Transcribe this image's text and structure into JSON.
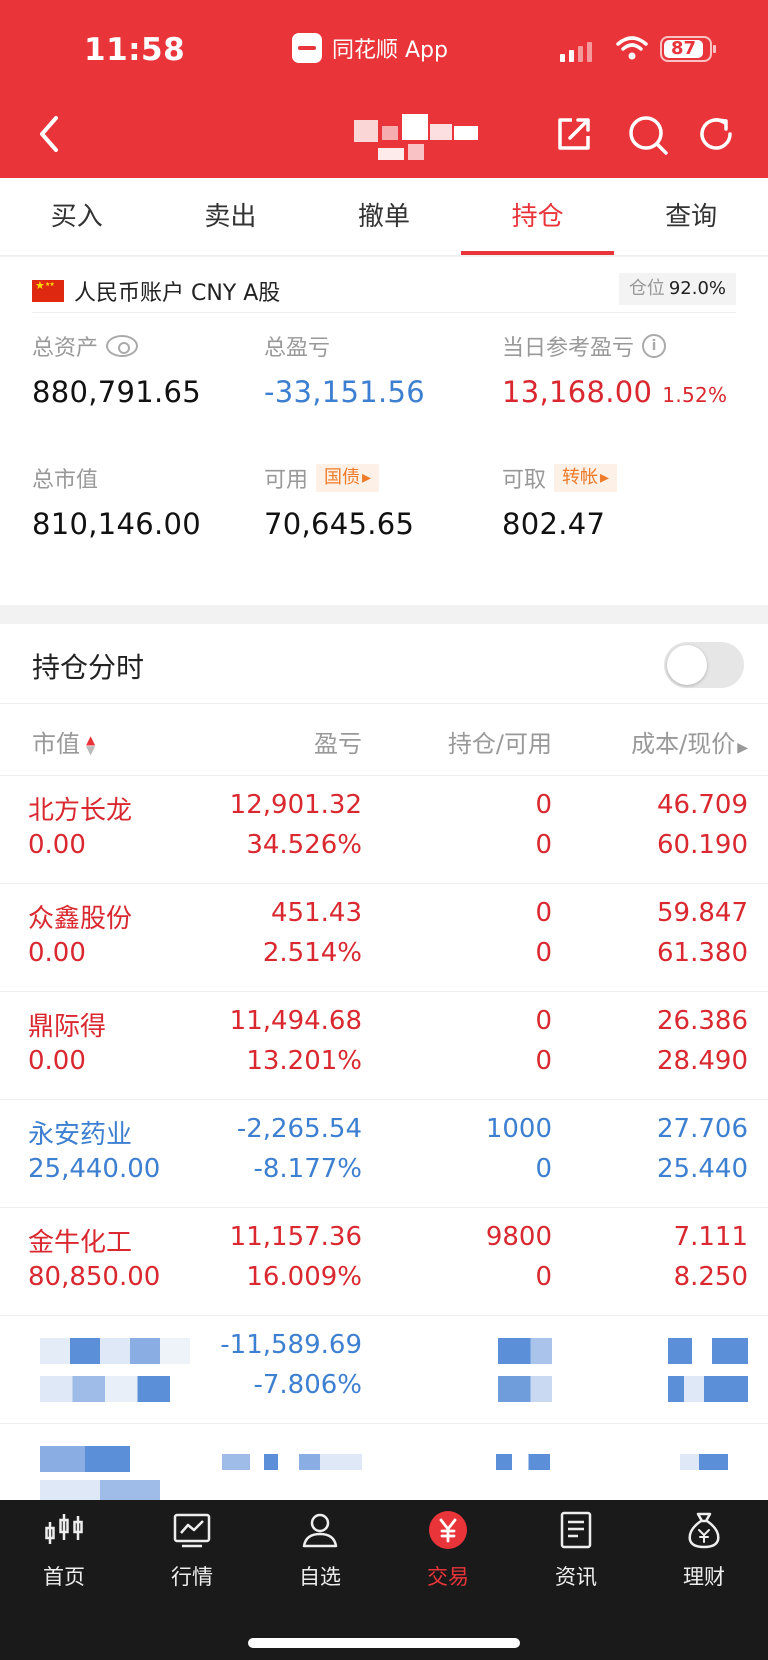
{
  "status": {
    "time": "11:58",
    "app": "同花顺 App",
    "battery": "87"
  },
  "tabs": [
    {
      "label": "买入",
      "active": false
    },
    {
      "label": "卖出",
      "active": false
    },
    {
      "label": "撤单",
      "active": false
    },
    {
      "label": "持仓",
      "active": true
    },
    {
      "label": "查询",
      "active": false
    }
  ],
  "account": {
    "label": "人民币账户 CNY A股",
    "position_label": "仓位",
    "position_value": "92.0%"
  },
  "metrics": {
    "total_assets_label": "总资产",
    "total_assets": "880,791.65",
    "total_pl_label": "总盈亏",
    "total_pl": "-33,151.56",
    "daily_pl_label": "当日参考盈亏",
    "daily_pl": "13,168.00",
    "daily_pl_pct": "1.52%",
    "market_value_label": "总市值",
    "market_value": "810,146.00",
    "available_label": "可用",
    "available_tag": "国债",
    "available": "70,645.65",
    "withdrawable_label": "可取",
    "withdrawable_tag": "转帐",
    "withdrawable": "802.47"
  },
  "holdings": {
    "title": "持仓分时",
    "columns": {
      "market_value": "市值",
      "pl": "盈亏",
      "qty": "持仓/可用",
      "cost": "成本/现价"
    },
    "rows": [
      {
        "name": "北方长龙",
        "mv": "0.00",
        "pl": "12,901.32",
        "pl_pct": "34.526%",
        "qty": "0",
        "avail": "0",
        "cost": "46.709",
        "price": "60.190",
        "color": "red"
      },
      {
        "name": "众鑫股份",
        "mv": "0.00",
        "pl": "451.43",
        "pl_pct": "2.514%",
        "qty": "0",
        "avail": "0",
        "cost": "59.847",
        "price": "61.380",
        "color": "red"
      },
      {
        "name": "鼎际得",
        "mv": "0.00",
        "pl": "11,494.68",
        "pl_pct": "13.201%",
        "qty": "0",
        "avail": "0",
        "cost": "26.386",
        "price": "28.490",
        "color": "red"
      },
      {
        "name": "永安药业",
        "mv": "25,440.00",
        "pl": "-2,265.54",
        "pl_pct": "-8.177%",
        "qty": "1000",
        "avail": "0",
        "cost": "27.706",
        "price": "25.440",
        "color": "blue"
      },
      {
        "name": "金牛化工",
        "mv": "80,850.00",
        "pl": "11,157.36",
        "pl_pct": "16.009%",
        "qty": "9800",
        "avail": "0",
        "cost": "7.111",
        "price": "8.250",
        "color": "red"
      }
    ],
    "obscured_row": {
      "pl": "-11,589.69",
      "pl_pct": "-7.806%"
    }
  },
  "tabbar": [
    {
      "label": "首页",
      "icon": "candlestick-icon"
    },
    {
      "label": "行情",
      "icon": "chart-icon"
    },
    {
      "label": "自选",
      "icon": "user-icon"
    },
    {
      "label": "交易",
      "icon": "yuan-icon",
      "active": true
    },
    {
      "label": "资讯",
      "icon": "news-icon"
    },
    {
      "label": "理财",
      "icon": "moneybag-icon"
    }
  ],
  "colors": {
    "brand": "#e9343a",
    "gain": "#d9282f",
    "loss": "#3d7fd0"
  }
}
